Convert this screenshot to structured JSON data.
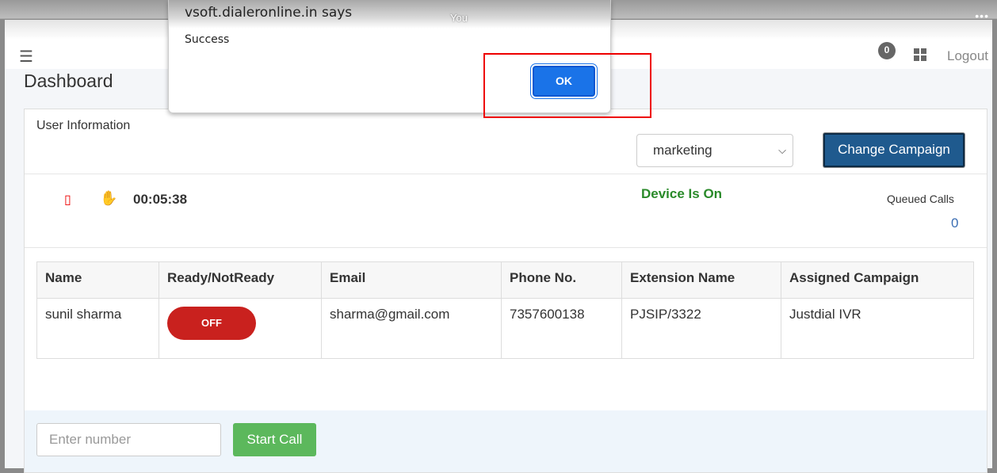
{
  "browser": {
    "overlay_label": "You",
    "menu_icon": "more-horizontal-icon"
  },
  "header": {
    "notification_count": "0",
    "logout": "Logout"
  },
  "page_title": "Dashboard",
  "user_info": {
    "title": "User Information",
    "campaign_select": "marketing",
    "change_campaign": "Change Campaign",
    "timer": "00:05:38",
    "device_status": "Device Is On",
    "queued_calls_label": "Queued Calls",
    "queued_calls": "0"
  },
  "table": {
    "headers": [
      "Name",
      "Ready/NotReady",
      "Email",
      "Phone No.",
      "Extension Name",
      "Assigned Campaign"
    ],
    "rows": [
      {
        "name": "sunil sharma",
        "status": "OFF",
        "email": "sharma@gmail.com",
        "phone": "7357600138",
        "extension": "PJSIP/3322",
        "campaign": "Justdial IVR"
      }
    ]
  },
  "call": {
    "placeholder": "Enter number",
    "start": "Start Call"
  },
  "dialog": {
    "title": "vsoft.dialeronline.in says",
    "message": "Success",
    "ok": "OK"
  },
  "colors": {
    "primary": "#1f5a8e",
    "off": "#c9211e",
    "start": "#5cb85c",
    "device_on": "#2a8a2a",
    "highlight": "#ee0000"
  }
}
